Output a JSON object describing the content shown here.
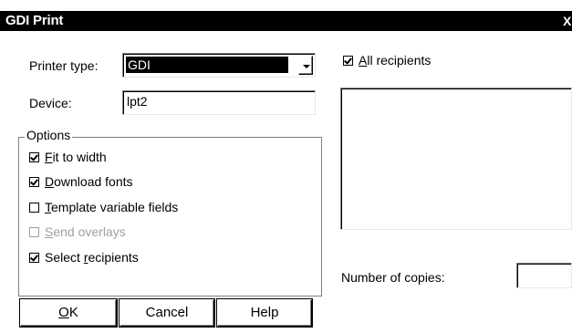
{
  "window": {
    "title": "GDI Print",
    "close_glyph": "X"
  },
  "printer_type": {
    "label": "Printer type:",
    "value": "GDI"
  },
  "device": {
    "label": "Device:",
    "value": "lpt2"
  },
  "options": {
    "legend": "Options",
    "items": [
      {
        "mn": "F",
        "rest": "it to width",
        "checked": true,
        "enabled": true
      },
      {
        "mn": "D",
        "rest": "ownload fonts",
        "checked": true,
        "enabled": true
      },
      {
        "mn": "T",
        "rest": "emplate variable fields",
        "checked": false,
        "enabled": true
      },
      {
        "mn": "S",
        "rest": "end overlays",
        "checked": false,
        "enabled": false
      },
      {
        "pre": "Select ",
        "mn": "r",
        "rest": "ecipients",
        "checked": true,
        "enabled": true
      }
    ]
  },
  "all_recipients": {
    "mn": "A",
    "rest": "ll recipients",
    "checked": true
  },
  "copies": {
    "label": "Number of copies:",
    "value": ""
  },
  "buttons": {
    "ok_mn": "O",
    "ok_rest": "K",
    "cancel": "Cancel",
    "help": "Help"
  }
}
